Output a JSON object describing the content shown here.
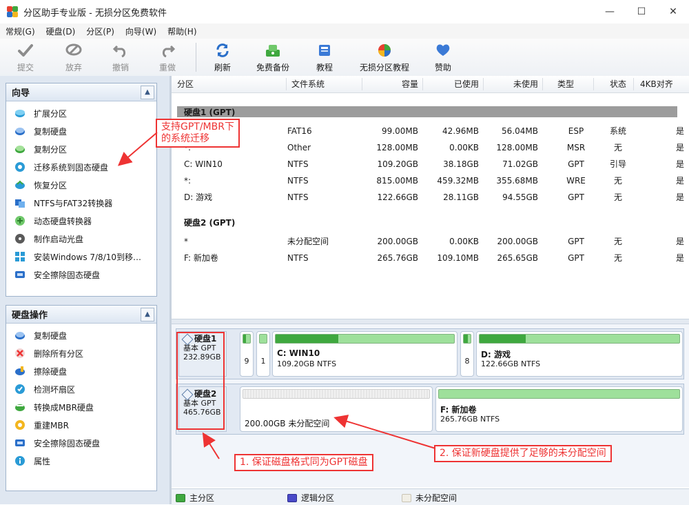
{
  "window": {
    "title": "分区助手专业版 - 无损分区免费软件",
    "controls": {
      "minimize": "—",
      "maximize": "☐",
      "close": "✕"
    }
  },
  "menu": [
    "常规(G)",
    "硬盘(D)",
    "分区(P)",
    "向导(W)",
    "帮助(H)"
  ],
  "toolbar": {
    "submit": "提交",
    "discard": "放弃",
    "undo": "撤销",
    "redo": "重做",
    "refresh": "刷新",
    "backup": "免费备份",
    "tutorial": "教程",
    "lossless_tutorial": "无损分区教程",
    "donate": "赞助"
  },
  "wizard_panel": {
    "title": "向导",
    "items": [
      {
        "label": "扩展分区",
        "icon": "extend-partition-icon"
      },
      {
        "label": "复制硬盘",
        "icon": "copy-disk-icon"
      },
      {
        "label": "复制分区",
        "icon": "copy-partition-icon"
      },
      {
        "label": "迁移系统到固态硬盘",
        "icon": "migrate-os-icon"
      },
      {
        "label": "恢复分区",
        "icon": "recover-partition-icon"
      },
      {
        "label": "NTFS与FAT32转换器",
        "icon": "ntfs-fat32-icon"
      },
      {
        "label": "动态硬盘转换器",
        "icon": "dynamic-disk-icon"
      },
      {
        "label": "制作启动光盘",
        "icon": "boot-disc-icon"
      },
      {
        "label": "安装Windows 7/8/10到移…",
        "icon": "windows-to-go-icon"
      },
      {
        "label": "安全擦除固态硬盘",
        "icon": "ssd-erase-icon"
      }
    ]
  },
  "disk_panel": {
    "title": "硬盘操作",
    "items": [
      {
        "label": "复制硬盘",
        "icon": "copy-disk-icon"
      },
      {
        "label": "删除所有分区",
        "icon": "delete-all-icon"
      },
      {
        "label": "擦除硬盘",
        "icon": "wipe-disk-icon"
      },
      {
        "label": "检测坏扇区",
        "icon": "bad-sector-icon"
      },
      {
        "label": "转换成MBR硬盘",
        "icon": "convert-mbr-icon"
      },
      {
        "label": "重建MBR",
        "icon": "rebuild-mbr-icon"
      },
      {
        "label": "安全擦除固态硬盘",
        "icon": "ssd-erase-icon"
      },
      {
        "label": "属性",
        "icon": "properties-icon"
      }
    ]
  },
  "table": {
    "columns": [
      "分区",
      "文件系统",
      "容量",
      "已使用",
      "未使用",
      "类型",
      "状态",
      "4KB对齐"
    ],
    "disks": [
      {
        "label": "硬盘1 (GPT)",
        "rows": [
          [
            "*:",
            "FAT16",
            "99.00MB",
            "42.96MB",
            "56.04MB",
            "ESP",
            "系统",
            "是"
          ],
          [
            "*:",
            "Other",
            "128.00MB",
            "0.00KB",
            "128.00MB",
            "MSR",
            "无",
            "是"
          ],
          [
            "C: WIN10",
            "NTFS",
            "109.20GB",
            "38.18GB",
            "71.02GB",
            "GPT",
            "引导",
            "是"
          ],
          [
            "*:",
            "NTFS",
            "815.00MB",
            "459.32MB",
            "355.68MB",
            "WRE",
            "无",
            "是"
          ],
          [
            "D: 游戏",
            "NTFS",
            "122.66GB",
            "28.11GB",
            "94.55GB",
            "GPT",
            "无",
            "是"
          ]
        ]
      },
      {
        "label": "硬盘2 (GPT)",
        "rows": [
          [
            "*",
            "未分配空间",
            "200.00GB",
            "0.00KB",
            "200.00GB",
            "GPT",
            "无",
            "是"
          ],
          [
            "F: 新加卷",
            "NTFS",
            "265.76GB",
            "109.10MB",
            "265.65GB",
            "GPT",
            "无",
            "是"
          ]
        ]
      }
    ]
  },
  "disk_map": {
    "disk1": {
      "name": "硬盘1",
      "type": "基本 GPT",
      "size": "232.89GB",
      "partitions": [
        {
          "num": "9",
          "fill": 0.43
        },
        {
          "num": "1",
          "fill": 0.0
        },
        {
          "name": "C: WIN10",
          "sub": "109.20GB NTFS",
          "fill": 0.35
        },
        {
          "num": "8",
          "fill": 0.56
        },
        {
          "name": "D: 游戏",
          "sub": "122.66GB NTFS",
          "fill": 0.23
        }
      ]
    },
    "disk2": {
      "name": "硬盘2",
      "type": "基本 GPT",
      "size": "465.76GB",
      "partitions": [
        {
          "sub": "200.00GB 未分配空间",
          "fill": 0.0
        },
        {
          "name": "F: 新加卷",
          "sub": "265.76GB NTFS",
          "fill": 0.0
        }
      ]
    }
  },
  "legend": {
    "primary": "主分区",
    "logical": "逻辑分区",
    "unallocated": "未分配空间"
  },
  "colors": {
    "accent": "#2a6fc9",
    "annotation": "#e33333",
    "primary_partition": "#3fa83f",
    "logical_partition": "#4a4ac8"
  },
  "annotations": {
    "note_migrate": [
      "支持GPT/MBR下",
      "的系统迁移"
    ],
    "note_format": "1. 保证磁盘格式同为GPT磁盘",
    "note_space": "2. 保证新硬盘提供了足够的未分配空间"
  }
}
